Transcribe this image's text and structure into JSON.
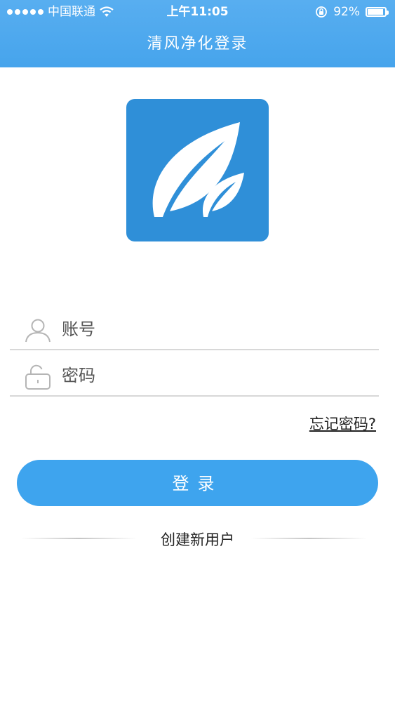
{
  "status_bar": {
    "carrier": "中国联通",
    "time": "上午11:05",
    "battery_percent": "92%",
    "battery_level": 0.92,
    "icons": [
      "signal-dots-icon",
      "wifi-icon",
      "orientation-lock-icon",
      "battery-icon"
    ]
  },
  "header": {
    "title": "清风净化登录"
  },
  "logo": {
    "icon": "leaf-logo-icon",
    "bg_color": "#2f8fd8"
  },
  "form": {
    "account": {
      "placeholder": "账号",
      "value": "",
      "icon": "user-icon"
    },
    "password": {
      "placeholder": "密码",
      "value": "",
      "icon": "lock-icon"
    }
  },
  "links": {
    "forgot_password": "忘记密码?"
  },
  "buttons": {
    "login": "登录"
  },
  "footer": {
    "create_account": "创建新用户"
  },
  "colors": {
    "accent": "#3ea4ee",
    "header": "#4aa7ee"
  }
}
